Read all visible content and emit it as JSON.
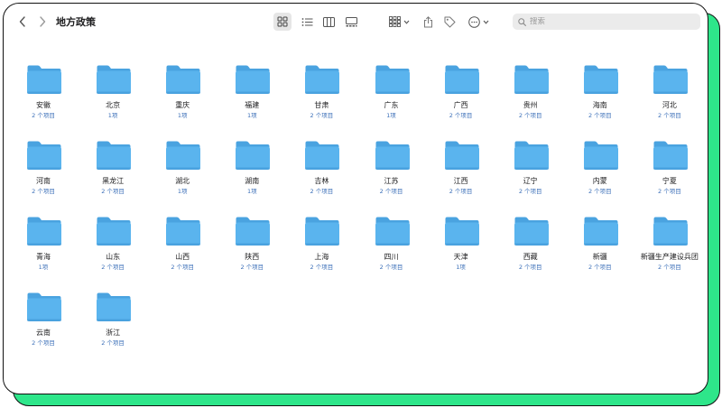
{
  "window": {
    "title": "地方政策"
  },
  "search": {
    "placeholder": "搜索"
  },
  "folders": [
    {
      "name": "安徽",
      "count": "2 个项目"
    },
    {
      "name": "北京",
      "count": "1项"
    },
    {
      "name": "重庆",
      "count": "1项"
    },
    {
      "name": "福建",
      "count": "1项"
    },
    {
      "name": "甘肃",
      "count": "2 个项目"
    },
    {
      "name": "广东",
      "count": "1项"
    },
    {
      "name": "广西",
      "count": "2 个项目"
    },
    {
      "name": "贵州",
      "count": "2 个项目"
    },
    {
      "name": "海南",
      "count": "2 个项目"
    },
    {
      "name": "河北",
      "count": "2 个项目"
    },
    {
      "name": "河南",
      "count": "2 个项目"
    },
    {
      "name": "黑龙江",
      "count": "2 个项目"
    },
    {
      "name": "湖北",
      "count": "1项"
    },
    {
      "name": "湖南",
      "count": "1项"
    },
    {
      "name": "吉林",
      "count": "2 个项目"
    },
    {
      "name": "江苏",
      "count": "2 个项目"
    },
    {
      "name": "江西",
      "count": "2 个项目"
    },
    {
      "name": "辽宁",
      "count": "2 个项目"
    },
    {
      "name": "内蒙",
      "count": "2 个项目"
    },
    {
      "name": "宁夏",
      "count": "2 个项目"
    },
    {
      "name": "青海",
      "count": "1项"
    },
    {
      "name": "山东",
      "count": "2 个项目"
    },
    {
      "name": "山西",
      "count": "2 个项目"
    },
    {
      "name": "陕西",
      "count": "2 个项目"
    },
    {
      "name": "上海",
      "count": "2 个项目"
    },
    {
      "name": "四川",
      "count": "2 个项目"
    },
    {
      "name": "天津",
      "count": "1项"
    },
    {
      "name": "西藏",
      "count": "2 个项目"
    },
    {
      "name": "新疆",
      "count": "2 个项目"
    },
    {
      "name": "新疆生产建设兵团",
      "count": "2 个项目"
    },
    {
      "name": "云南",
      "count": "2 个项目"
    },
    {
      "name": "浙江",
      "count": "2 个项目"
    }
  ],
  "colors": {
    "folder_body": "#5ab4ee",
    "folder_tab": "#4aa3e0",
    "count_text": "#3b6fb8",
    "shadow": "#2ee68a"
  }
}
